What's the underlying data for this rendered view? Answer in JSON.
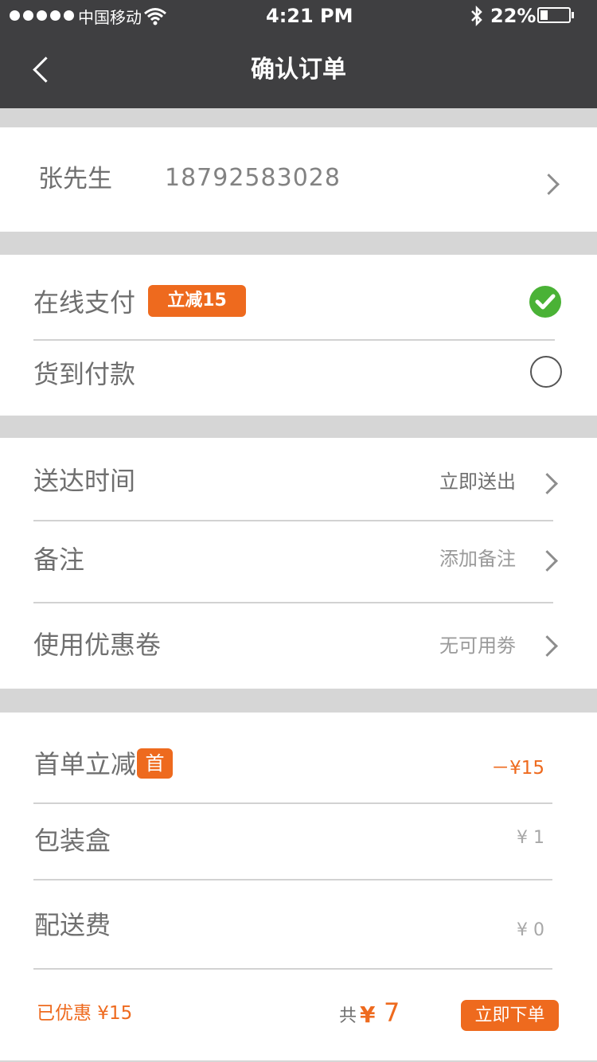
{
  "status_bar": {
    "carrier": "中国移动",
    "time": "4:21 PM",
    "battery": "22%"
  },
  "nav": {
    "title": "确认订单",
    "back_icon": "chevron-left-icon"
  },
  "contact": {
    "name": "张先生",
    "phone": "18792583028"
  },
  "payment": {
    "online_label": "在线支付",
    "online_badge": "立减15",
    "online_selected": true,
    "cod_label": "货到付款",
    "cod_selected": false
  },
  "options": [
    {
      "label": "送达时间",
      "value": "立即送出"
    },
    {
      "label": "备注",
      "value": "添加备注"
    },
    {
      "label": "使用优惠卷",
      "value": "无可用劵"
    }
  ],
  "fees": {
    "first_order_label": "首单立减",
    "first_order_badge": "首",
    "first_order_value": "－¥15",
    "box_label": "包装盒",
    "box_value": "¥ 1",
    "delivery_label": "配送费",
    "delivery_value": "¥ 0"
  },
  "footer": {
    "discount_text": "已优惠 ¥15",
    "total_prefix": "共",
    "total_currency": "¥",
    "total_value": "7",
    "submit_label": "立即下单"
  },
  "colors": {
    "accent": "#ee6a1e",
    "check_green": "#4ab236",
    "header_bg": "#3f3f41"
  }
}
